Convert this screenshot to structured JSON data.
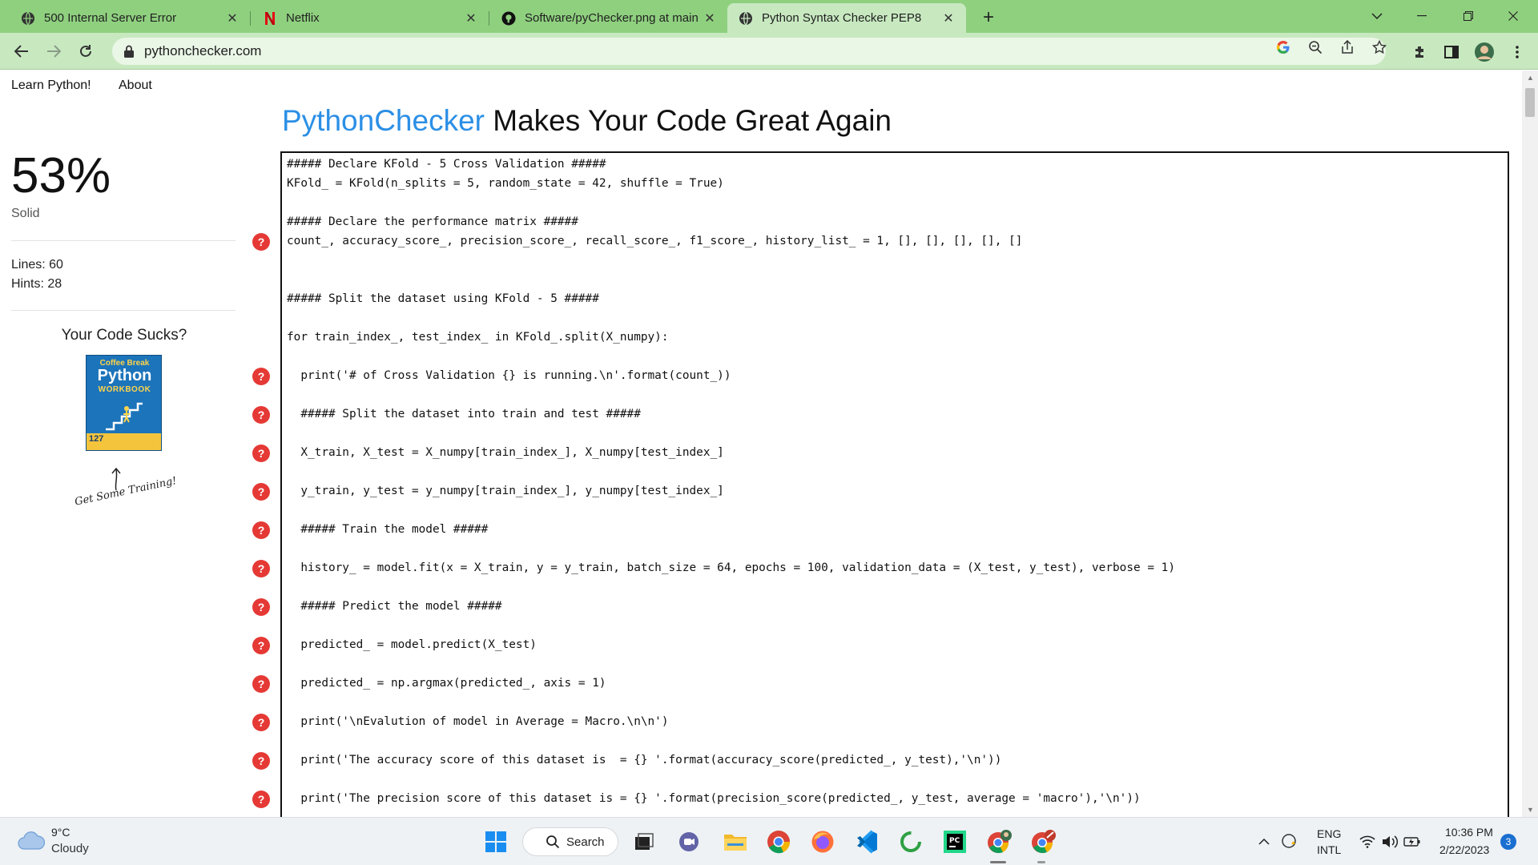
{
  "browser": {
    "tabs": [
      {
        "label": "500 Internal Server Error",
        "icon": "globe-icon"
      },
      {
        "label": "Netflix",
        "icon": "netflix-icon"
      },
      {
        "label": "Software/pyChecker.png at main",
        "icon": "github-icon"
      },
      {
        "label": "Python Syntax Checker PEP8",
        "icon": "globe-icon",
        "active": true
      }
    ],
    "url": "pythonchecker.com",
    "theme_color": "#8fd07f"
  },
  "nav": {
    "learn": "Learn Python!",
    "about": "About"
  },
  "sidebar": {
    "score": "53%",
    "rating": "Solid",
    "lines": "Lines: 60",
    "hints": "Hints: 28",
    "promo_title": "Your Code Sucks?",
    "book": {
      "line1": "Coffee Break",
      "line2": "Python",
      "line3": "WORKBOOK",
      "number": "127"
    },
    "handwriting": "Get Some Training!"
  },
  "header": {
    "brand": "PythonChecker",
    "tagline": " Makes Your Code Great Again"
  },
  "editor": {
    "lines": [
      {
        "text": "##### Declare KFold - 5 Cross Validation #####",
        "hint": false
      },
      {
        "text": "KFold_ = KFold(n_splits = 5, random_state = 42, shuffle = True)",
        "hint": false
      },
      {
        "text": "",
        "hint": false
      },
      {
        "text": "##### Declare the performance matrix #####",
        "hint": false
      },
      {
        "text": "count_, accuracy_score_, precision_score_, recall_score_, f1_score_, history_list_ = 1, [], [], [], [], []",
        "hint": true
      },
      {
        "text": "",
        "hint": false
      },
      {
        "text": "",
        "hint": false
      },
      {
        "text": "##### Split the dataset using KFold - 5 #####",
        "hint": false
      },
      {
        "text": "",
        "hint": false
      },
      {
        "text": "for train_index_, test_index_ in KFold_.split(X_numpy):",
        "hint": false
      },
      {
        "text": "",
        "hint": false
      },
      {
        "text": "  print('# of Cross Validation {} is running.\\n'.format(count_))",
        "hint": true
      },
      {
        "text": "",
        "hint": false
      },
      {
        "text": "  ##### Split the dataset into train and test #####",
        "hint": true
      },
      {
        "text": "",
        "hint": false
      },
      {
        "text": "  X_train, X_test = X_numpy[train_index_], X_numpy[test_index_]",
        "hint": true
      },
      {
        "text": "",
        "hint": false
      },
      {
        "text": "  y_train, y_test = y_numpy[train_index_], y_numpy[test_index_]",
        "hint": true
      },
      {
        "text": "",
        "hint": false
      },
      {
        "text": "  ##### Train the model #####",
        "hint": true
      },
      {
        "text": "",
        "hint": false
      },
      {
        "text": "  history_ = model.fit(x = X_train, y = y_train, batch_size = 64, epochs = 100, validation_data = (X_test, y_test), verbose = 1)",
        "hint": true
      },
      {
        "text": "",
        "hint": false
      },
      {
        "text": "  ##### Predict the model #####",
        "hint": true
      },
      {
        "text": "",
        "hint": false
      },
      {
        "text": "  predicted_ = model.predict(X_test)",
        "hint": true
      },
      {
        "text": "",
        "hint": false
      },
      {
        "text": "  predicted_ = np.argmax(predicted_, axis = 1)",
        "hint": true
      },
      {
        "text": "",
        "hint": false
      },
      {
        "text": "  print('\\nEvalution of model in Average = Macro.\\n\\n')",
        "hint": true
      },
      {
        "text": "",
        "hint": false
      },
      {
        "text": "  print('The accuracy score of this dataset is  = {} '.format(accuracy_score(predicted_, y_test),'\\n'))",
        "hint": true
      },
      {
        "text": "",
        "hint": false
      },
      {
        "text": "  print('The precision score of this dataset is = {} '.format(precision_score(predicted_, y_test, average = 'macro'),'\\n'))",
        "hint": true
      }
    ]
  },
  "taskbar": {
    "weather_temp": "9°C",
    "weather_desc": "Cloudy",
    "search": "Search",
    "lang1": "ENG",
    "lang2": "INTL",
    "time": "10:36 PM",
    "date": "2/22/2023",
    "notifications": "3"
  }
}
